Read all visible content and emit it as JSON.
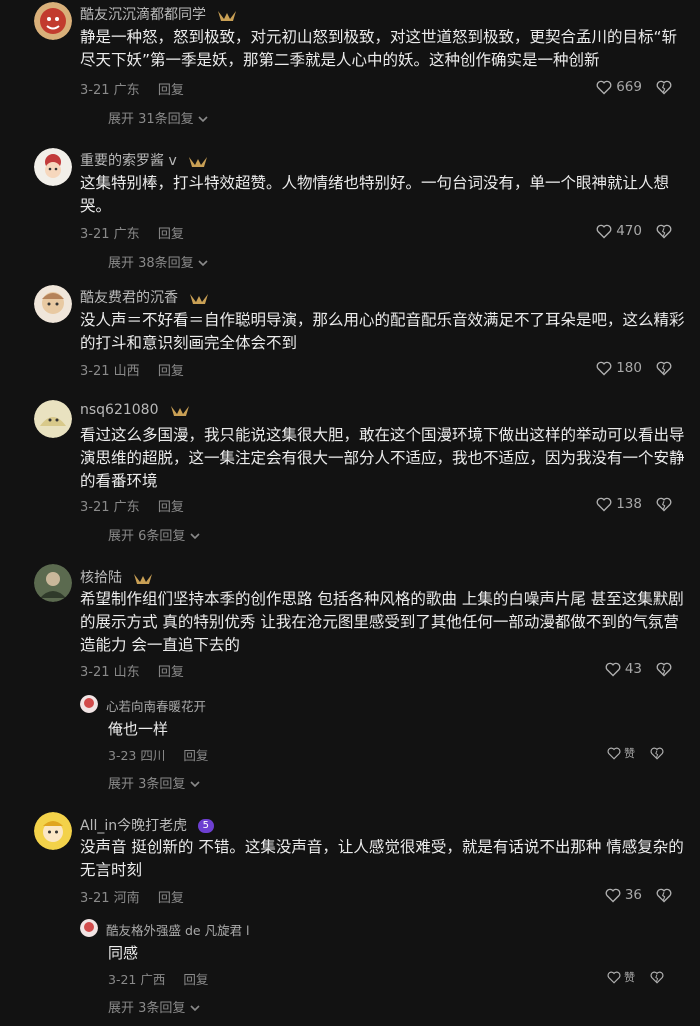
{
  "comments": [
    {
      "username": "酷友沉沉滴都都同学",
      "text": "静是一种怒，怒到极致，对元初山怒到极致，对这世道怒到极致，更契合孟川的目标“斩尽天下妖”第一季是妖，那第二季就是人心中的妖。这种创作确实是一种创新",
      "date": "3-21",
      "location": "广东",
      "reply_label": "回复",
      "likes": "669",
      "expand": "展开 31条回复"
    },
    {
      "username": "重要的索罗酱 v",
      "text": "这集特别棒，打斗特效超赞。人物情绪也特别好。一句台词没有，单一个眼神就让人想哭。",
      "date": "3-21",
      "location": "广东",
      "reply_label": "回复",
      "likes": "470",
      "expand": "展开 38条回复"
    },
    {
      "username": "酷友费君的沉香",
      "text": "没人声＝不好看＝自作聪明导演，那么用心的配音配乐音效满足不了耳朵是吧，这么精彩的打斗和意识刻画完全体会不到",
      "date": "3-21",
      "location": "山西",
      "reply_label": "回复",
      "likes": "180",
      "expand": ""
    },
    {
      "username": "nsq621080",
      "text": "看过这么多国漫，我只能说这集很大胆，敢在这个国漫环境下做出这样的举动可以看出导演思维的超脱，这一集注定会有很大一部分人不适应，我也不适应，因为我没有一个安静的看番环境",
      "date": "3-21",
      "location": "广东",
      "reply_label": "回复",
      "likes": "138",
      "expand": "展开 6条回复"
    },
    {
      "username": "核拾陆",
      "text": "希望制作组们坚持本季的创作思路 包括各种风格的歌曲 上集的白噪声片尾 甚至这集默剧的展示方式 真的特别优秀 让我在沧元图里感受到了其他任何一部动漫都做不到的气氛营造能力 会一直追下去的",
      "date": "3-21",
      "location": "山东",
      "reply_label": "回复",
      "likes": "43",
      "sub_reply": {
        "username": "心若向南春暖花开",
        "text": "俺也一样",
        "date": "3-23",
        "location": "四川",
        "reply_label": "回复",
        "likes": "赞"
      },
      "expand": "展开 3条回复"
    },
    {
      "username": "All_in今晚打老虎",
      "level": "5",
      "text": "没声音 挺创新的 不错。这集没声音，让人感觉很难受，就是有话说不出那种 情感复杂的无言时刻",
      "date": "3-21",
      "location": "河南",
      "reply_label": "回复",
      "likes": "36",
      "sub_reply": {
        "username": "酷友格外强盛 de 凡旋君 l",
        "text": "同感",
        "date": "3-21",
        "location": "广西",
        "reply_label": "回复",
        "likes": "赞"
      },
      "expand": "展开 3条回复"
    }
  ],
  "icons": {
    "like": "heart-icon",
    "dislike": "broken-heart-icon",
    "expand": "chevron-down-icon",
    "badge": "vip-badge-icon"
  },
  "colors": {
    "background": "#121212",
    "username": "#b9b9b9",
    "body": "#ececec",
    "meta": "#8a8a8a",
    "badge": "#c9a055",
    "level_badge": "#8b5cf6"
  }
}
